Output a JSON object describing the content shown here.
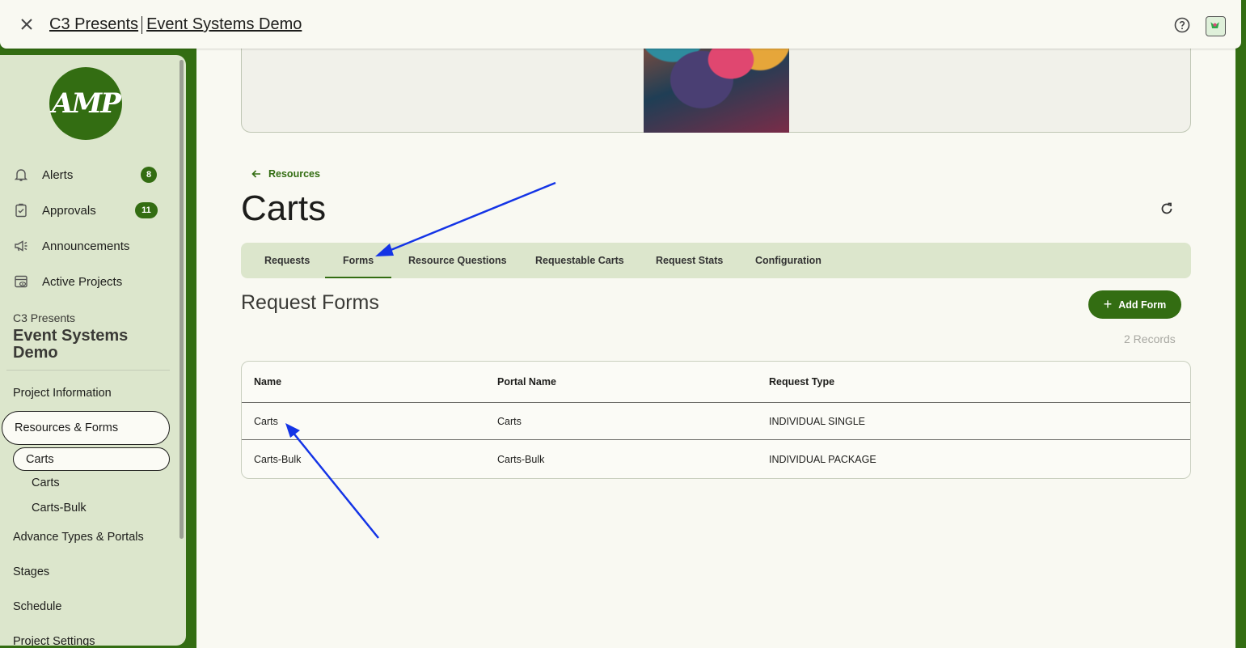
{
  "topbar": {
    "org": "C3 Presents",
    "project": "Event Systems Demo"
  },
  "sidebar": {
    "logo_text": "AMP",
    "nav": [
      {
        "label": "Alerts",
        "icon": "bell-icon",
        "badge": "8"
      },
      {
        "label": "Approvals",
        "icon": "clipboard-check-icon",
        "badge": "11"
      },
      {
        "label": "Announcements",
        "icon": "megaphone-icon"
      },
      {
        "label": "Active Projects",
        "icon": "projects-icon"
      }
    ],
    "project_org": "C3 Presents",
    "project_name": "Event Systems Demo",
    "menu": {
      "project_information": "Project Information",
      "resources_forms": "Resources & Forms",
      "carts_selected": "Carts",
      "carts_form": "Carts",
      "carts_bulk_form": "Carts-Bulk",
      "advance_types": "Advance Types & Portals",
      "stages": "Stages",
      "schedule": "Schedule",
      "project_settings": "Project Settings"
    }
  },
  "main": {
    "back_label": "Resources",
    "title": "Carts",
    "tabs": [
      {
        "label": "Requests"
      },
      {
        "label": "Forms",
        "active": true
      },
      {
        "label": "Resource Questions"
      },
      {
        "label": "Requestable Carts"
      },
      {
        "label": "Request Stats"
      },
      {
        "label": "Configuration"
      }
    ],
    "section_title": "Request Forms",
    "add_button": "Add Form",
    "records": "2 Records",
    "table": {
      "headers": [
        "Name",
        "Portal Name",
        "Request Type"
      ],
      "rows": [
        [
          "Carts",
          "Carts",
          "INDIVIDUAL SINGLE"
        ],
        [
          "Carts-Bulk",
          "Carts-Bulk",
          "INDIVIDUAL PACKAGE"
        ]
      ]
    }
  },
  "colors": {
    "brand_green": "#336d12",
    "sidebar_bg": "#dce6cc",
    "page_bg": "#f9f9f2",
    "annotation_arrow": "#1434e6"
  }
}
